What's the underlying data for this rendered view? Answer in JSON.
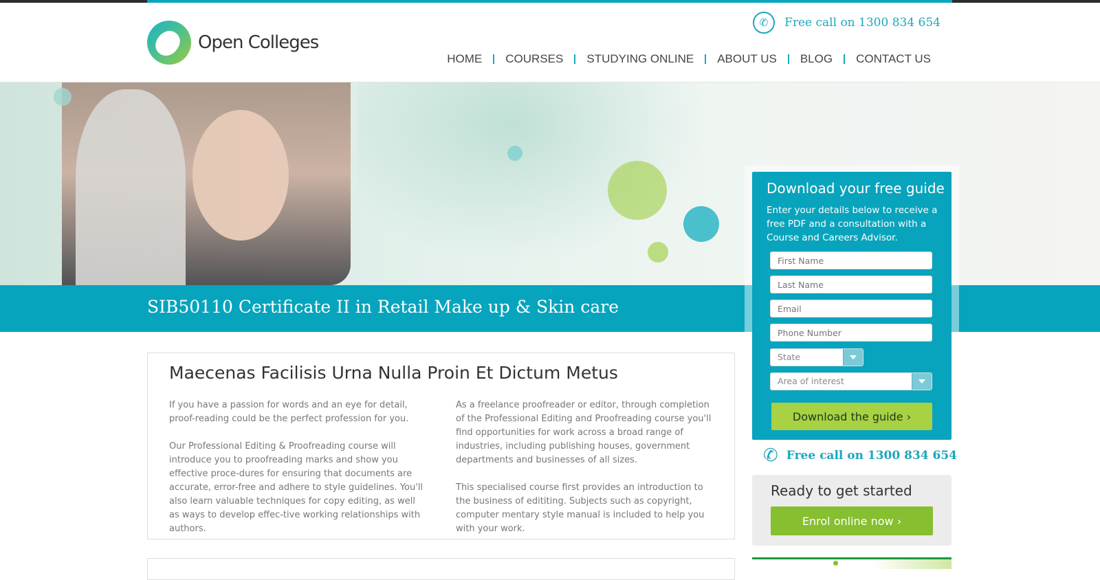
{
  "brand": {
    "name": "Open Colleges"
  },
  "header": {
    "phone_text": "Free call on 1300 834 654",
    "nav": [
      "HOME",
      "COURSES",
      "STUDYING ONLINE",
      "ABOUT US",
      "BLOG",
      "CONTACT US"
    ]
  },
  "hero": {
    "course_title": "SIB50110 Certificate II in Retail Make up & Skin care"
  },
  "content": {
    "heading": "Maecenas Facilisis Urna Nulla Proin Et Dictum Metus",
    "left_paragraphs": [
      "If you have a passion for words and an eye for detail, proof-reading could be the perfect profession for you.",
      "Our Professional Editing & Proofreading course will introduce you to proofreading marks and show you effective proce-dures for ensuring that documents are accurate, error-free and adhere to style guidelines. You'll also learn valuable techniques for copy editing, as well as ways to develop effec-tive working relationships with authors."
    ],
    "right_paragraphs": [
      "As a freelance proofreader or editor, through completion of the Professional Editing and Proofreading course you'll find opportunities for work across a broad range of industries, including publishing houses, government departments and businesses of all sizes.",
      "This specialised course first provides an introduction to the business of edititing. Subjects such as copyright, computer mentary style manual is included to help you with your work."
    ]
  },
  "form": {
    "title": "Download your free guide",
    "intro": "Enter your details below to receive a free PDF and a consultation with a Course and Careers Advisor.",
    "first_name_placeholder": "First Name",
    "last_name_placeholder": "Last Name",
    "email_placeholder": "Email",
    "phone_placeholder": "Phone Number",
    "state_label": "State",
    "area_label": "Area of interest",
    "submit_label": "Download the guide ›"
  },
  "sidebar": {
    "phone_text": "Free call on 1300 834 654",
    "ready_title": "Ready to get started",
    "enrol_label": "Enrol online now ›"
  },
  "colors": {
    "teal": "#06a4bd",
    "lime": "#a8d143",
    "green": "#86bf2f"
  }
}
